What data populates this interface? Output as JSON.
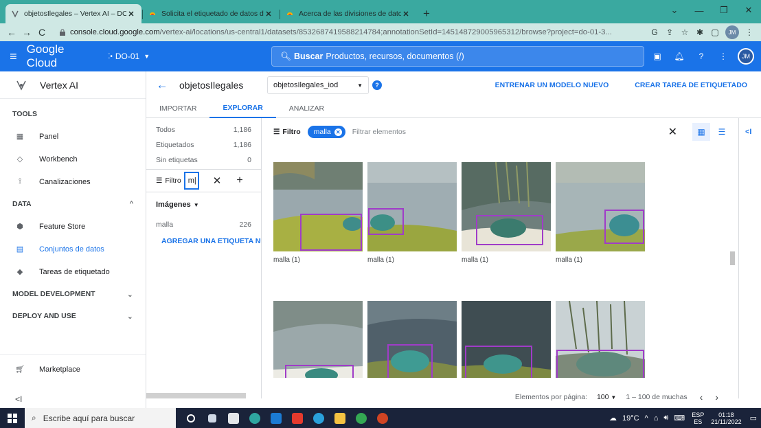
{
  "browser": {
    "tabs": [
      {
        "title": "objetosIlegales – Vertex AI – DO-",
        "active": true
      },
      {
        "title": "Solicita el etiquetado de datos d",
        "active": false
      },
      {
        "title": "Acerca de las divisiones de datos",
        "active": false
      }
    ],
    "url_host": "console.cloud.google.com",
    "url_path": "/vertex-ai/locations/us-central1/datasets/8532687419588214784;annotationSetId=145148729005965312/browse?project=do-01-3..."
  },
  "header": {
    "brand": "Google Cloud",
    "project": "DO-01",
    "search_label": "Buscar",
    "search_text": "Productos, recursos, documentos (/)",
    "avatar": "JM",
    "colors": {
      "primary": "#1a73e8",
      "browser_frame": "#3aa9a0"
    }
  },
  "sidebar": {
    "product": "Vertex AI",
    "sections": {
      "tools": "TOOLS",
      "data": "DATA",
      "model_dev": "MODEL DEVELOPMENT",
      "deploy": "DEPLOY AND USE"
    },
    "items": {
      "panel": "Panel",
      "workbench": "Workbench",
      "pipelines": "Canalizaciones",
      "feature_store": "Feature Store",
      "datasets": "Conjuntos de datos",
      "labeling": "Tareas de etiquetado",
      "marketplace": "Marketplace"
    }
  },
  "main": {
    "title": "objetosIlegales",
    "annotation_set": "objetosIlegales_iod",
    "train_btn": "ENTRENAR UN MODELO NUEVO",
    "labeling_task_btn": "CREAR TAREA DE ETIQUETADO",
    "tabs": [
      "IMPORTAR",
      "EXPLORAR",
      "ANALIZAR"
    ],
    "active_tab": "EXPLORAR"
  },
  "labels_panel": {
    "counts": [
      {
        "label": "Todos",
        "value": "1,186"
      },
      {
        "label": "Etiquetados",
        "value": "1,186"
      },
      {
        "label": "Sin etiquetas",
        "value": "0"
      }
    ],
    "filter_label": "Filtro",
    "filter_value": "m|",
    "type_label": "Imágenes",
    "labels": [
      {
        "label": "malla",
        "value": "226"
      }
    ],
    "add_label": "AGREGAR UNA ETIQUETA NUE"
  },
  "grid": {
    "filter_label": "Filtro",
    "chip": "malla",
    "placeholder": "Filtrar elementos",
    "items": [
      {
        "label": "malla (1)"
      },
      {
        "label": "malla (1)"
      },
      {
        "label": "malla (1)"
      },
      {
        "label": "malla (1)"
      },
      {
        "label": ""
      },
      {
        "label": ""
      },
      {
        "label": ""
      },
      {
        "label": ""
      }
    ]
  },
  "pager": {
    "per_page_label": "Elementos por página:",
    "per_page": "100",
    "range": "1 – 100 de muchas"
  },
  "taskbar": {
    "search": "Escribe aquí para buscar",
    "temp": "19°C",
    "lang_top": "ESP",
    "lang_bottom": "ES",
    "time": "01:18",
    "date": "21/11/2022"
  }
}
